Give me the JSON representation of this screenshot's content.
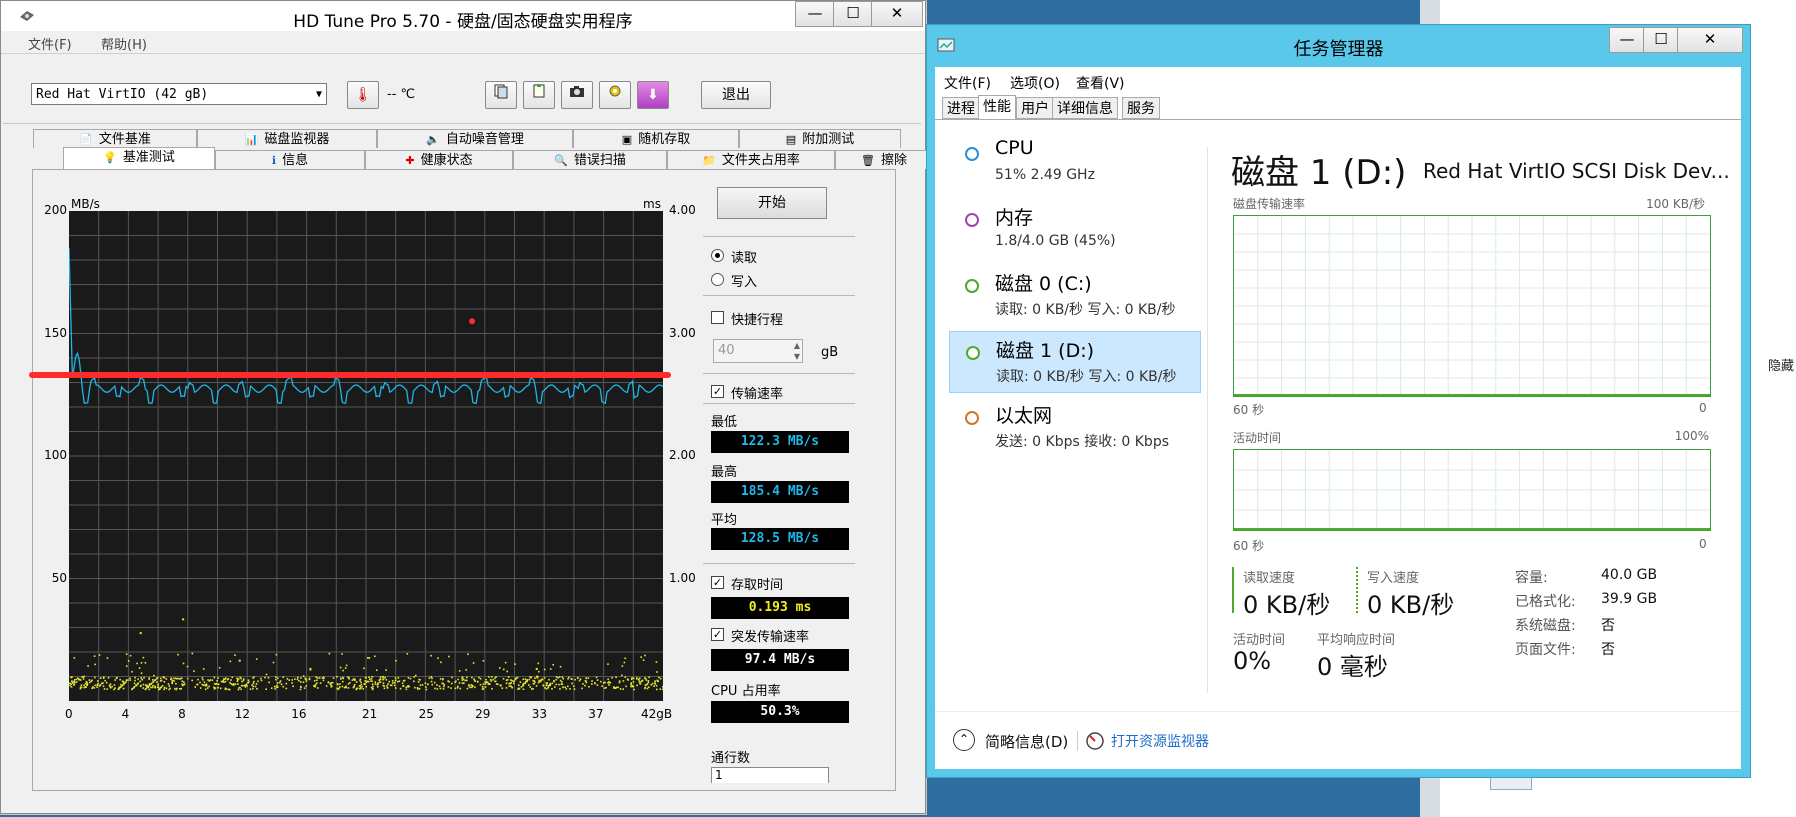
{
  "background": {
    "hidden_text": "隐藏"
  },
  "hdtune": {
    "title": "HD Tune Pro 5.70 - 硬盘/固态硬盘实用程序",
    "controls": {
      "minimize": "—",
      "maximize": "☐",
      "close": "✕"
    },
    "menu": [
      "文件(F)",
      "帮助(H)"
    ],
    "drive": "Red Hat VirtIO (42 gB)",
    "temperature": "-- ℃",
    "exit_label": "退出",
    "tabs_top": [
      {
        "label": "文件基准",
        "icon": "file-benchmark-icon"
      },
      {
        "label": "磁盘监视器",
        "icon": "disk-monitor-icon"
      },
      {
        "label": "自动噪音管理",
        "icon": "speaker-icon"
      },
      {
        "label": "随机存取",
        "icon": "random-access-icon"
      },
      {
        "label": "附加测试",
        "icon": "extra-tests-icon"
      }
    ],
    "tabs_bottom": [
      {
        "label": "基准测试",
        "icon": "benchmark-icon"
      },
      {
        "label": "信息",
        "icon": "info-icon"
      },
      {
        "label": "健康状态",
        "icon": "health-icon"
      },
      {
        "label": "错误扫描",
        "icon": "error-scan-icon"
      },
      {
        "label": "文件夹占用率",
        "icon": "folder-usage-icon"
      },
      {
        "label": "擦除",
        "icon": "erase-icon"
      }
    ],
    "start_label": "开始",
    "read_label": "读取",
    "write_label": "写入",
    "quick_label": "快捷行程",
    "quick_value": "40",
    "quick_unit": "gB",
    "transfer_label": "传输速率",
    "min_label": "最低",
    "min_value": "122.3 MB/s",
    "max_label": "最高",
    "max_value": "185.4 MB/s",
    "avg_label": "平均",
    "avg_value": "128.5 MB/s",
    "access_label": "存取时间",
    "access_value": "0.193 ms",
    "burst_label": "突发传输速率",
    "burst_value": "97.4 MB/s",
    "cpu_label": "CPU 占用率",
    "cpu_value": "50.3%",
    "lanes_label": "通行数",
    "lanes_value": "1",
    "colors": {
      "transfer": "#1fb6e8",
      "access": "#e8e830",
      "marker": "#ff2a2a"
    }
  },
  "chart_data": {
    "type": "line",
    "title": "",
    "ylabel_left": "MB/s",
    "ylabel_right": "ms",
    "xlabel": "",
    "x_ticks": [
      "0",
      "4",
      "8",
      "12",
      "16",
      "21",
      "25",
      "29",
      "33",
      "37",
      "42gB"
    ],
    "y_left_ticks": [
      "200",
      "150",
      "100",
      "50"
    ],
    "y_right_ticks": [
      "4.00",
      "3.00",
      "2.00",
      "1.00"
    ],
    "ylim_left": [
      0,
      200
    ],
    "ylim_right": [
      0,
      4
    ],
    "xlim": [
      0,
      42
    ],
    "grid": true,
    "series": [
      {
        "name": "传输速率",
        "axis": "left",
        "x": [
          0,
          0.2,
          0.7,
          1,
          1.4,
          2,
          3,
          4,
          5,
          6,
          8,
          10,
          12,
          14,
          16,
          18,
          20,
          22,
          24,
          26,
          28,
          30,
          32,
          34,
          36,
          38,
          40,
          42
        ],
        "values": [
          185,
          128,
          142,
          128,
          127,
          122,
          128,
          127,
          123,
          128,
          127,
          122,
          128,
          127,
          124,
          128,
          127,
          123,
          128,
          127,
          124,
          128,
          127,
          123,
          128,
          127,
          128,
          128
        ]
      },
      {
        "name": "存取时间",
        "axis": "right",
        "type": "scatter",
        "note_range": [
          0.1,
          0.4
        ]
      }
    ],
    "highlight_line_value": 133,
    "marker_point": {
      "x": 28.5,
      "y": 155
    }
  },
  "taskmgr": {
    "title": "任务管理器",
    "controls": {
      "minimize": "—",
      "maximize": "☐",
      "close": "✕"
    },
    "menu": [
      "文件(F)",
      "选项(O)",
      "查看(V)"
    ],
    "tabs": [
      "进程",
      "性能",
      "用户",
      "详细信息",
      "服务"
    ],
    "active_tab": "性能",
    "side": [
      {
        "title": "CPU",
        "sub": "51% 2.49 GHz",
        "color": "#2d8ed1"
      },
      {
        "title": "内存",
        "sub": "1.8/4.0 GB (45%)",
        "color": "#a340b4"
      },
      {
        "title": "磁盘 0 (C:)",
        "sub": "读取: 0 KB/秒 写入: 0 KB/秒",
        "color": "#4caa2c"
      },
      {
        "title": "磁盘 1 (D:)",
        "sub": "读取: 0 KB/秒 写入: 0 KB/秒",
        "color": "#4caa2c"
      },
      {
        "title": "以太网",
        "sub": "发送: 0 Kbps 接收: 0 Kbps",
        "color": "#d0742a"
      }
    ],
    "main_title": "磁盘 1 (D:)",
    "device": "Red Hat VirtIO SCSI Disk Dev...",
    "chart1_label": "磁盘传输速率",
    "chart1_max": "100 KB/秒",
    "chart1_left": "60 秒",
    "chart1_right": "0",
    "chart2_label": "活动时间",
    "chart2_max": "100%",
    "chart2_left": "60 秒",
    "chart2_right": "0",
    "read_speed_label": "读取速度",
    "read_speed": "0 KB/秒",
    "write_speed_label": "写入速度",
    "write_speed": "0 KB/秒",
    "active_time_label": "活动时间",
    "active_time": "0%",
    "avg_resp_label": "平均响应时间",
    "avg_resp": "0 毫秒",
    "capacity_label": "容量:",
    "capacity": "40.0 GB",
    "formatted_label": "已格式化:",
    "formatted": "39.9 GB",
    "system_disk_label": "系统磁盘:",
    "system_disk": "否",
    "page_file_label": "页面文件:",
    "page_file": "否",
    "brief_label": "简略信息(D)",
    "resmon_label": "打开资源监视器"
  }
}
